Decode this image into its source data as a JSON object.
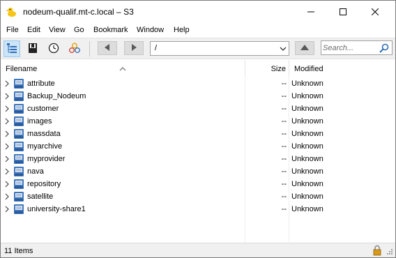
{
  "window": {
    "title": "nodeum-qualif.mt-c.local – S3"
  },
  "menu": [
    "File",
    "Edit",
    "View",
    "Go",
    "Bookmark",
    "Window",
    "Help"
  ],
  "toolbar": {
    "path_value": "/",
    "search_placeholder": "Search..."
  },
  "columns": {
    "filename": "Filename",
    "size": "Size",
    "modified": "Modified"
  },
  "rows": [
    {
      "name": "attribute",
      "size": "--",
      "modified": "Unknown"
    },
    {
      "name": "Backup_Nodeum",
      "size": "--",
      "modified": "Unknown"
    },
    {
      "name": "customer",
      "size": "--",
      "modified": "Unknown"
    },
    {
      "name": "images",
      "size": "--",
      "modified": "Unknown"
    },
    {
      "name": "massdata",
      "size": "--",
      "modified": "Unknown"
    },
    {
      "name": "myarchive",
      "size": "--",
      "modified": "Unknown"
    },
    {
      "name": "myprovider",
      "size": "--",
      "modified": "Unknown"
    },
    {
      "name": "nava",
      "size": "--",
      "modified": "Unknown"
    },
    {
      "name": "repository",
      "size": "--",
      "modified": "Unknown"
    },
    {
      "name": "satellite",
      "size": "--",
      "modified": "Unknown"
    },
    {
      "name": "university-share1",
      "size": "--",
      "modified": "Unknown"
    }
  ],
  "status": {
    "text": "11 Items"
  },
  "colors": {
    "accent": "#2f6db5",
    "toolbar_bg": "#f0f0f0",
    "active_tool_bg": "#cce4f7"
  }
}
